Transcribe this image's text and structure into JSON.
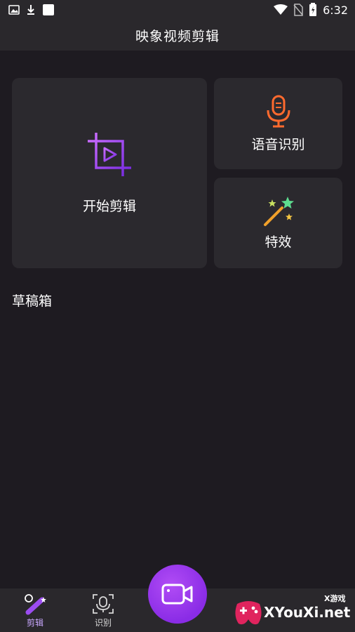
{
  "status_bar": {
    "time": "6:32",
    "icons": [
      "image-icon",
      "download-icon",
      "square-icon",
      "wifi-icon",
      "no-sim-icon",
      "battery-icon"
    ]
  },
  "header": {
    "title": "映象视频剪辑"
  },
  "cards": {
    "start_edit": {
      "label": "开始剪辑",
      "icon": "crop-play-icon"
    },
    "voice": {
      "label": "语音识别",
      "icon": "microphone-icon"
    },
    "effects": {
      "label": "特效",
      "icon": "magic-wand-icon"
    }
  },
  "drafts": {
    "label": "草稿箱"
  },
  "bottom_nav": {
    "tabs": [
      {
        "label": "剪辑",
        "icon": "edit-wand-icon",
        "active": true
      },
      {
        "label": "识别",
        "icon": "voice-scan-icon",
        "active": false
      }
    ],
    "fab_icon": "video-camera-icon"
  },
  "watermark": {
    "brand": "XYouXi.net",
    "tag": "X游戏"
  },
  "colors": {
    "background": "#1e1b21",
    "card": "#2b292e",
    "bar": "#2a282c",
    "accent_purple": "#8a2ce6",
    "mic_orange": "#ff6a2e"
  }
}
